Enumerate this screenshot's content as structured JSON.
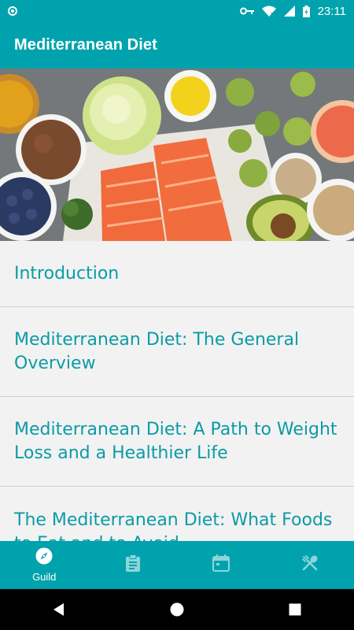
{
  "status_bar": {
    "time": "23:11",
    "icons": [
      "notification-dot-icon",
      "key-icon",
      "wifi-icon",
      "signal-icon",
      "battery-icon"
    ]
  },
  "app_bar": {
    "title": "Mediterranean Diet"
  },
  "hero": {
    "image_subject": "mediterranean-food-image"
  },
  "list": {
    "items": [
      {
        "label": "Introduction"
      },
      {
        "label": "Mediterranean Diet: The General Overview"
      },
      {
        "label": "Mediterranean Diet: A Path to Weight Loss and a Healthier Life"
      },
      {
        "label": "The Mediterranean Diet: What Foods to Eat and to Avoid"
      }
    ]
  },
  "bottom_nav": {
    "items": [
      {
        "label": "Guild",
        "icon": "compass-icon",
        "active": true
      },
      {
        "label": "",
        "icon": "clipboard-icon",
        "active": false
      },
      {
        "label": "",
        "icon": "calendar-icon",
        "active": false
      },
      {
        "label": "",
        "icon": "utensils-icon",
        "active": false
      }
    ]
  },
  "system_nav": {
    "buttons": [
      "back-icon",
      "home-icon",
      "recents-icon"
    ]
  },
  "colors": {
    "primary": "#00a3ad",
    "list_text": "#0b9ba6",
    "background": "#f2f2f2"
  }
}
